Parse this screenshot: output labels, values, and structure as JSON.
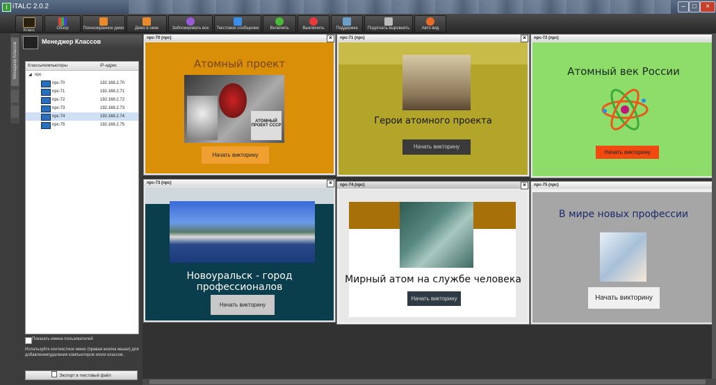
{
  "app": {
    "title": "iTALC 2.0.2"
  },
  "toolbar": {
    "buttons": [
      {
        "label": "Класс",
        "color": "#5a4a2a"
      },
      {
        "label": "Обзор",
        "color": "#d44"
      },
      {
        "label": "Полноэкранное демо",
        "color": "#e88a2a"
      },
      {
        "label": "Демо в окне",
        "color": "#e88a2a"
      },
      {
        "label": "Заблокировать все",
        "color": "#9a5ad8"
      },
      {
        "label": "Текстовое сообщение",
        "color": "#3a8ee8"
      },
      {
        "label": "Включить",
        "color": "#4ab83a"
      },
      {
        "label": "Выключить",
        "color": "#e83a3a"
      },
      {
        "label": "Поддержка",
        "color": "#6aa0c8"
      },
      {
        "label": "Подогнать выровнять",
        "color": "#bbbbbb"
      },
      {
        "label": "Авто вид",
        "color": "#e86a2a"
      }
    ]
  },
  "sidebar": {
    "title": "Менеджер Классов",
    "vertical_tab": "Менеджер Классов",
    "columns": {
      "name": "Классы/компьютеры",
      "ip": "IP-адрес"
    },
    "group": "npc",
    "computers": [
      {
        "name": "npc-70",
        "ip": "192.168.2.70"
      },
      {
        "name": "npc-71",
        "ip": "192.168.2.71"
      },
      {
        "name": "npc-72",
        "ip": "192.168.2.72"
      },
      {
        "name": "npc-73",
        "ip": "192.168.2.73"
      },
      {
        "name": "npc-74",
        "ip": "192.168.2.74"
      },
      {
        "name": "npc-75",
        "ip": "192.168.2.75"
      }
    ],
    "show_usernames": "Показать имена пользователей",
    "hint": "Используйте контекстное меню (правая кнопка мыши) для добавления/удаления компьютеров и/или классов.",
    "export_button": "Экспорт в текстовый файл"
  },
  "windows": [
    {
      "title": "npc-70 (npc)",
      "heading": "Атомный проект",
      "button": "Начать викторину",
      "photo_text": "АТОМНЫЙ ПРОЕКТ СССР"
    },
    {
      "title": "npc-71 (npc)",
      "heading": "Герои атомного проекта",
      "button": "Начать викторину"
    },
    {
      "title": "npc-72 (npc)",
      "heading": "Атомный век России",
      "button": "Начать викторину"
    },
    {
      "title": "npc-73 (npc)",
      "heading": "Новоуральск - город профессионалов",
      "button": "Начать викторину"
    },
    {
      "title": "npc-74 (npc)",
      "heading": "Мирный атом на службе человека",
      "button": "Начать викторину"
    },
    {
      "title": "npc-75 (npc)",
      "heading": "В мире новых профессии",
      "button": "Начать викторину"
    }
  ],
  "close_glyph": "×"
}
